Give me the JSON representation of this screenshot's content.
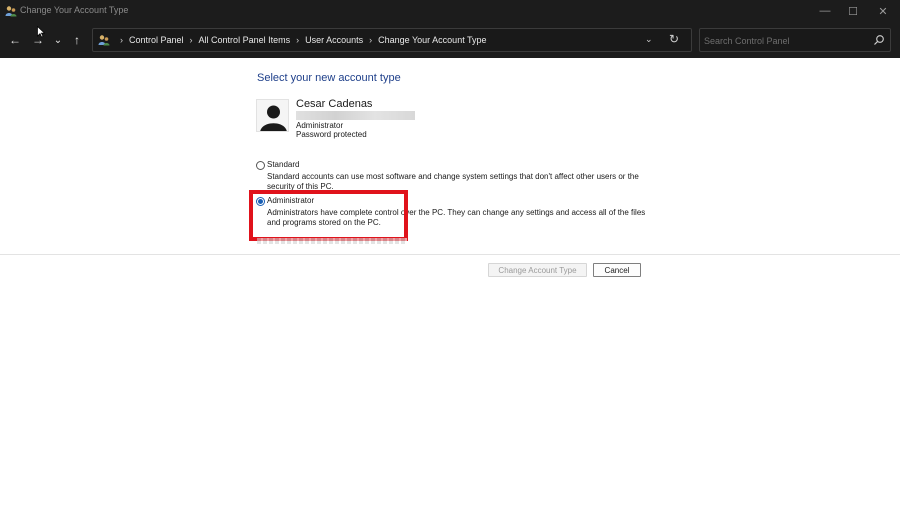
{
  "window": {
    "title": "Change Your Account Type",
    "minimize": "—",
    "maximize": "☐",
    "close": "✕"
  },
  "nav": {
    "back": "←",
    "forward": "→",
    "recent": "⌄",
    "up": "↑"
  },
  "address": {
    "crumbs": [
      "Control Panel",
      "All Control Panel Items",
      "User Accounts",
      "Change Your Account Type"
    ],
    "separator": "›",
    "dropdown": "⌄",
    "refresh": "↻"
  },
  "search": {
    "placeholder": "Search Control Panel"
  },
  "main": {
    "heading": "Select your new account type",
    "account": {
      "name": "Cesar Cadenas",
      "role": "Administrator",
      "status": "Password protected"
    },
    "options": [
      {
        "label": "Standard",
        "description": "Standard accounts can use most software and change system settings that don't affect other users or the security of this PC.",
        "selected": false
      },
      {
        "label": "Administrator",
        "description": "Administrators have complete control over the PC. They can change any settings and access all of the files and programs stored on the PC.",
        "selected": true
      }
    ],
    "buttons": {
      "change": "Change Account Type",
      "cancel": "Cancel"
    }
  },
  "colors": {
    "heading": "#1e3f8a",
    "highlight": "#e0121b",
    "chrome": "#1c1c1c",
    "radio_selected": "#1a5fb4"
  }
}
